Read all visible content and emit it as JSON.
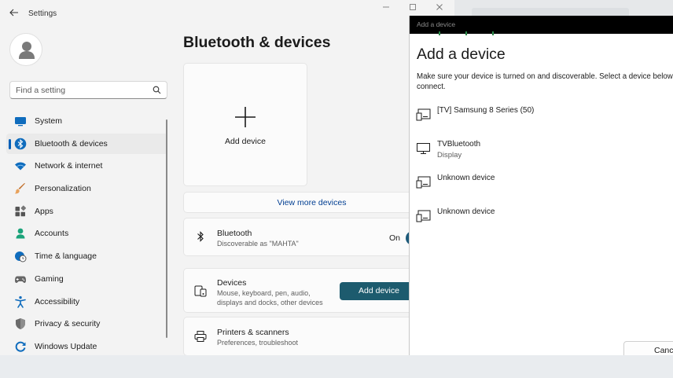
{
  "settings": {
    "app_title": "Settings",
    "search_placeholder": "Find a setting",
    "page_title": "Bluetooth & devices",
    "nav": [
      {
        "label": "System",
        "icon": "monitor-icon",
        "active": false
      },
      {
        "label": "Bluetooth & devices",
        "icon": "bluetooth-icon",
        "active": true
      },
      {
        "label": "Network & internet",
        "icon": "wifi-icon",
        "active": false
      },
      {
        "label": "Personalization",
        "icon": "brush-icon",
        "active": false
      },
      {
        "label": "Apps",
        "icon": "apps-icon",
        "active": false
      },
      {
        "label": "Accounts",
        "icon": "accounts-icon",
        "active": false
      },
      {
        "label": "Time & language",
        "icon": "clock-globe-icon",
        "active": false
      },
      {
        "label": "Gaming",
        "icon": "gamepad-icon",
        "active": false
      },
      {
        "label": "Accessibility",
        "icon": "accessibility-icon",
        "active": false
      },
      {
        "label": "Privacy & security",
        "icon": "shield-icon",
        "active": false
      },
      {
        "label": "Windows Update",
        "icon": "update-icon",
        "active": false
      }
    ],
    "add_card_label": "Add device",
    "view_more_label": "View more devices",
    "bluetooth": {
      "title": "Bluetooth",
      "subtitle": "Discoverable as \"MAHTA\"",
      "state_label": "On",
      "enabled": true
    },
    "devices": {
      "title": "Devices",
      "subtitle_line1": "Mouse, keyboard, pen, audio,",
      "subtitle_line2": "displays and docks, other devices",
      "button_label": "Add device"
    },
    "printers": {
      "title": "Printers & scanners",
      "subtitle": "Preferences, troubleshoot"
    }
  },
  "dialog": {
    "window_title": "Add a device",
    "heading": "Add a device",
    "description_line1": "Make sure your device is turned on and discoverable. Select a device below to",
    "description_line2": "connect.",
    "devices": [
      {
        "name": "[TV] Samsung 8 Series (50)",
        "type": "",
        "icon": "generic-device-icon"
      },
      {
        "name": "TVBluetooth",
        "type": "Display",
        "icon": "display-icon"
      },
      {
        "name": "Unknown device",
        "type": "",
        "icon": "generic-device-icon"
      },
      {
        "name": "Unknown device",
        "type": "",
        "icon": "generic-device-icon"
      }
    ],
    "cancel_label": "Cancel"
  },
  "colors": {
    "accent": "#1d5b6e",
    "link": "#003e92",
    "nav_indicator": "#005fb8"
  }
}
